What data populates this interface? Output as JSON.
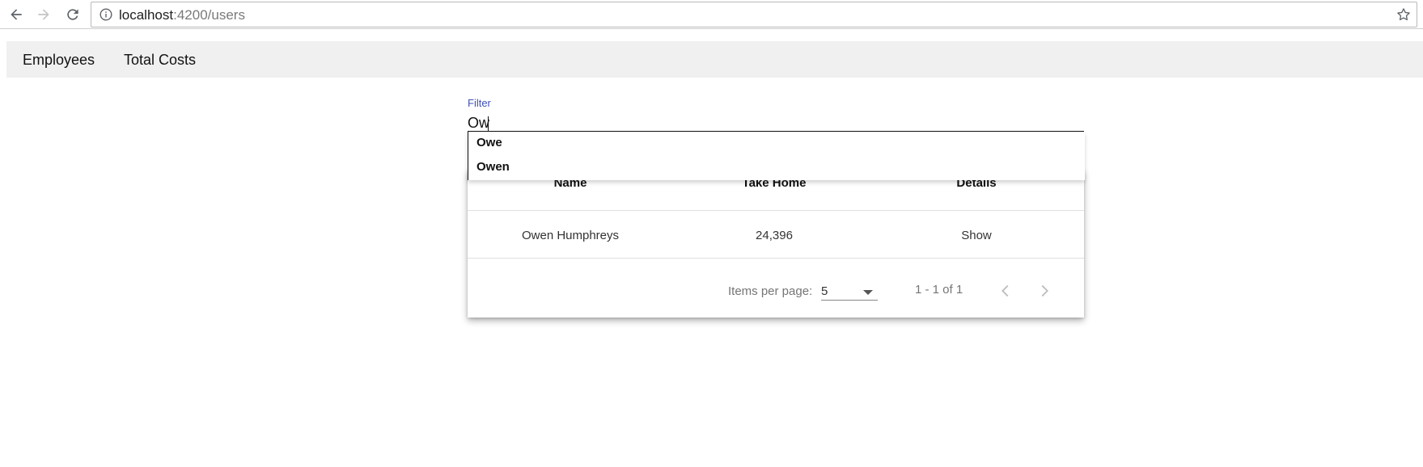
{
  "browser": {
    "url_host": "localhost",
    "url_rest": ":4200/users"
  },
  "nav": {
    "items": [
      {
        "label": "Employees"
      },
      {
        "label": "Total Costs"
      }
    ]
  },
  "filter": {
    "label": "Filter",
    "value": "Ow",
    "suggestions": [
      {
        "label": "Owe"
      },
      {
        "label": "Owen"
      }
    ]
  },
  "table": {
    "columns": [
      {
        "label": "Name"
      },
      {
        "label": "Take Home"
      },
      {
        "label": "Details"
      }
    ],
    "rows": [
      {
        "name": "Owen Humphreys",
        "take_home": "24,396",
        "details": "Show"
      }
    ]
  },
  "paginator": {
    "items_per_page_label": "Items per page:",
    "page_size": "5",
    "range_label": "1 - 1 of 1"
  },
  "colors": {
    "accent": "#3f51b5",
    "nav_background": "#f0f0f0"
  }
}
